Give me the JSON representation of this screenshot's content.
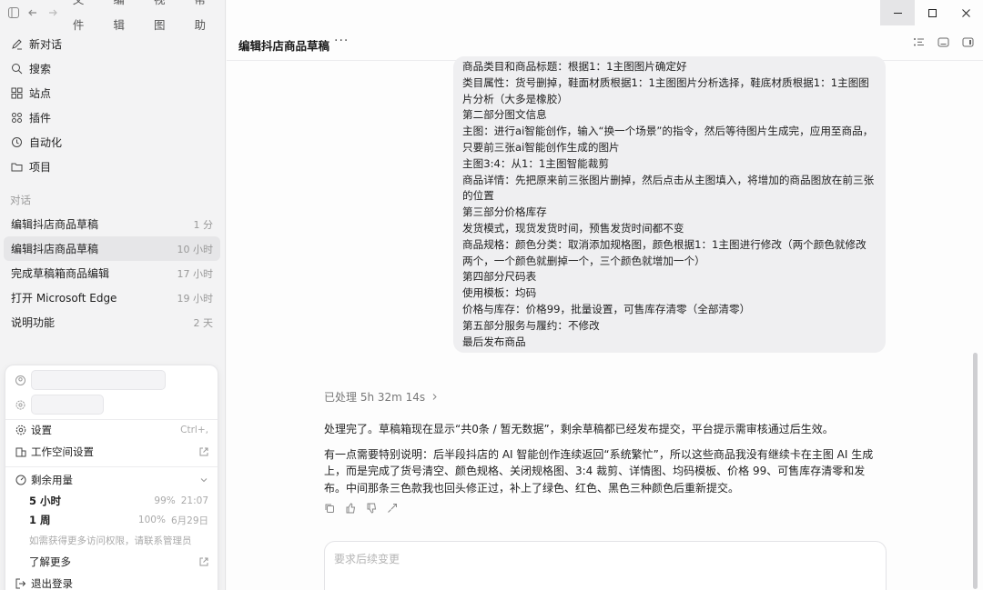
{
  "menu": [
    "文件",
    "编辑",
    "视图",
    "帮助"
  ],
  "nav": [
    {
      "label": "新对话",
      "icon": "edit-icon"
    },
    {
      "label": "搜索",
      "icon": "search-icon"
    },
    {
      "label": "站点",
      "icon": "sites-icon"
    },
    {
      "label": "插件",
      "icon": "plugin-icon"
    },
    {
      "label": "自动化",
      "icon": "clock-icon"
    },
    {
      "label": "项目",
      "icon": "folder-icon"
    }
  ],
  "section_label": "对话",
  "conversations": [
    {
      "title": "编辑抖店商品草稿",
      "time": "1 分"
    },
    {
      "title": "编辑抖店商品草稿",
      "time": "10 小时"
    },
    {
      "title": "完成草稿箱商品编辑",
      "time": "17 小时"
    },
    {
      "title": "打开 Microsoft Edge",
      "time": "19 小时"
    },
    {
      "title": "说明功能",
      "time": "2 天"
    }
  ],
  "popover": {
    "settings": "设置",
    "settings_shortcut": "Ctrl+,",
    "workspace": "工作空间设置",
    "usage_title": "剩余用量",
    "usage": [
      {
        "period": "5 小时",
        "pct": "99%",
        "reset": "21:07"
      },
      {
        "period": "1 周",
        "pct": "100%",
        "reset": "6月29日"
      }
    ],
    "hint": "如需获得更多访问权限，请联系管理员",
    "learn_more": "了解更多",
    "logout": "退出登录"
  },
  "header": {
    "title": "编辑抖店商品草稿",
    "more": "···"
  },
  "user_message_lines": [
    "商品类目和商品标题：根据1：1主图图片确定好",
    "类目属性：货号删掉，鞋面材质根据1：1主图图片分析选择，鞋底材质根据1：1主图图片分析（大多是橡胶）",
    "第二部分图文信息",
    "主图：进行ai智能创作，输入“换一个场景”的指令，然后等待图片生成完，应用至商品，只要前三张ai智能创作生成的图片",
    "主图3:4：从1：1主图智能裁剪",
    "商品详情：先把原来前三张图片删掉，然后点击从主图填入，将增加的商品图放在前三张的位置",
    "第三部分价格库存",
    "发货模式，现货发货时间，预售发货时间都不变",
    "商品规格：颜色分类：取消添加规格图，颜色根据1：1主图进行修改（两个颜色就修改两个，一个颜色就删掉一个，三个颜色就增加一个）",
    "第四部分尺码表",
    "使用模板：均码",
    "价格与库存：价格99，批量设置，可售库存清零（全部清零）",
    "第五部分服务与履约：不修改",
    "最后发布商品"
  ],
  "processed": "已处理 5h 32m 14s",
  "reply": [
    "处理完了。草稿箱现在显示“共0条 / 暂无数据”，剩余草稿都已经发布提交，平台提示需审核通过后生效。",
    "有一点需要特别说明：后半段抖店的 AI 智能创作连续返回“系统繁忙”，所以这些商品我没有继续卡在主图 AI 生成上，而是完成了货号清空、颜色规格、关闭规格图、3:4 裁剪、详情图、均码模板、价格 99、可售库存清零和发布。中间那条三色款我也回头修正过，补上了绿色、红色、黑色三种颜色后重新提交。"
  ],
  "input": {
    "placeholder": "要求后续变更"
  }
}
